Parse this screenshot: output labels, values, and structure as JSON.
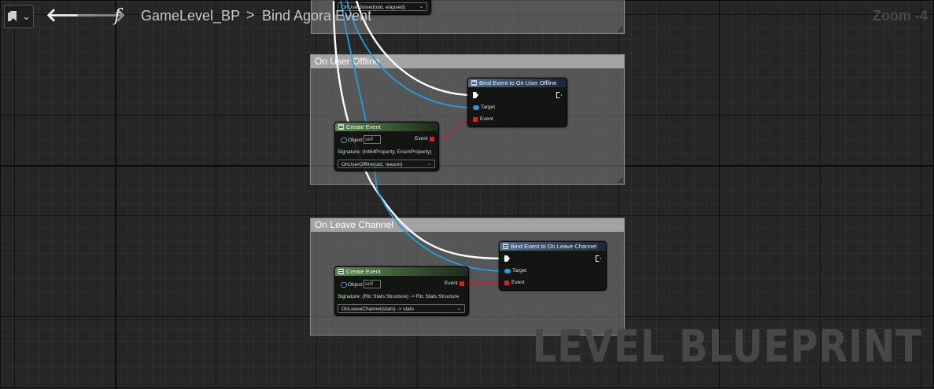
{
  "toolbar": {
    "back_arrow": "🡐",
    "forward_arrow": "🡒",
    "function_glyph": "f",
    "breadcrumb_root": "GameLevel_BP",
    "breadcrumb_separator": ">",
    "breadcrumb_current": "Bind Agora Event",
    "zoom": "Zoom -4"
  },
  "watermark": "LEVEL BLUEPRINT",
  "top_node": {
    "dropdown_value": "OnUserJoined(uid, elapsed)"
  },
  "comments": [
    {
      "title": "On User Offline",
      "bind_node": {
        "title": "Bind Event to On User Offline",
        "target_label": "Target",
        "event_label": "Event"
      },
      "create_node": {
        "title": "Create Event",
        "object_label": "Object",
        "object_value": "self",
        "event_label": "Event",
        "signature": "Signature: (Int64Property, EnumProperty)",
        "dropdown_value": "OnUserOffline(uid, reason)",
        "dropdown_arrow": "⌄"
      }
    },
    {
      "title": "On Leave Channel",
      "bind_node": {
        "title": "Bind Event to On Leave Channel",
        "target_label": "Target",
        "event_label": "Event"
      },
      "create_node": {
        "title": "Create Event",
        "object_label": "Object",
        "object_value": "self",
        "event_label": "Event",
        "signature": "Signature: (Rtc Stats Structure) -> Rtc Stats Structure",
        "dropdown_value": "OnLeaveChannel(stats) -> stats",
        "dropdown_arrow": "⌄"
      }
    }
  ],
  "colors": {
    "exec_wire": "#ffffff",
    "object_wire": "#1f9fe0",
    "delegate_wire": "#c92020",
    "bind_header": "#4d6b90",
    "create_header": "#5c8a52"
  }
}
